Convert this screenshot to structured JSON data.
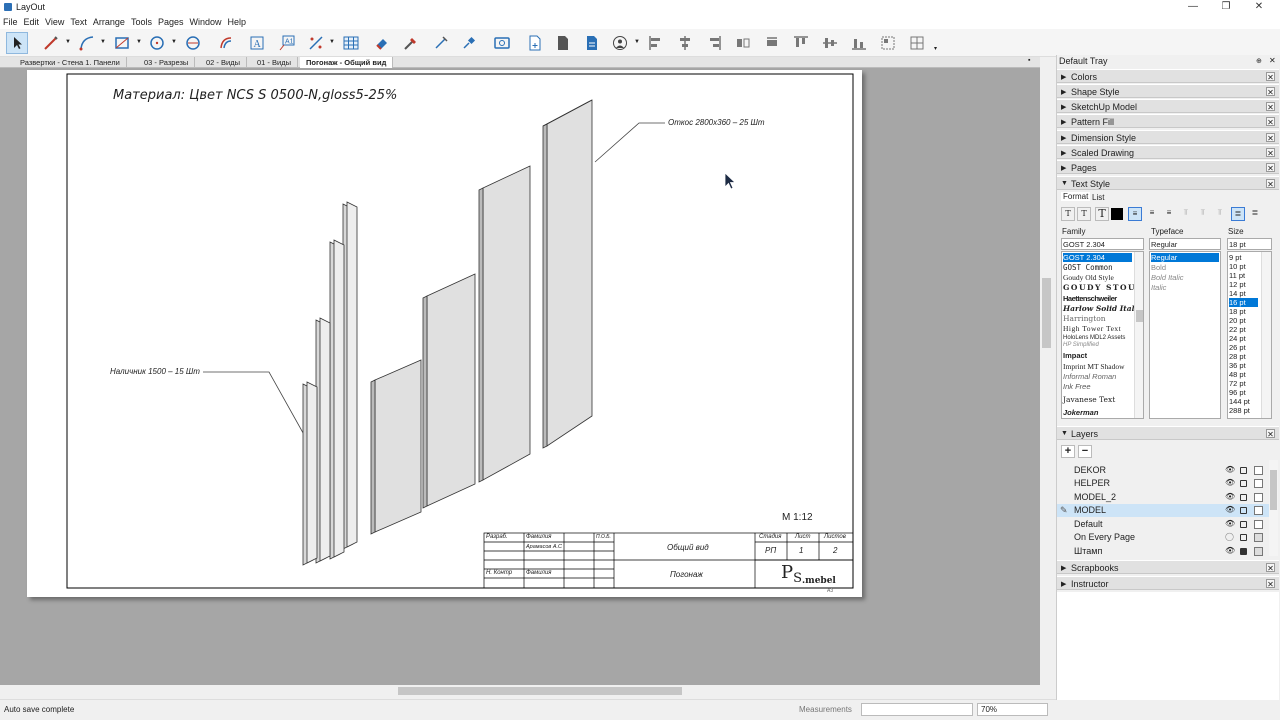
{
  "window": {
    "title": "LayOut",
    "minimize": "—",
    "maximize": "❐",
    "close": "✕"
  },
  "menu": [
    "File",
    "Edit",
    "View",
    "Text",
    "Arrange",
    "Tools",
    "Pages",
    "Window",
    "Help"
  ],
  "toolbar_icons": [
    "select-tool",
    "line-tool",
    "arc-tool",
    "rectangle-tool",
    "circle-tool",
    "polygon-tool",
    "offset-tool",
    "text-tool",
    "label-tool",
    "dimension-tool",
    "table-tool",
    "eraser-tool",
    "style-tool",
    "split-tool",
    "join-tool",
    "presentation",
    "add-page",
    "insert",
    "link",
    "user",
    "align-left",
    "align-center",
    "align-right",
    "flip",
    "rotate",
    "space",
    "distribute",
    "join",
    "group",
    "ungroup"
  ],
  "tabs": [
    "Развертки - Стена 1. Панели",
    "03 - Разрезы",
    "02 - Виды",
    "01 - Виды",
    "Погонаж - Общий вид"
  ],
  "tab_close": "▪",
  "drawing": {
    "title": "Материал: Цвет NCS S 0500-N,gloss5-25%",
    "callout_right": "Откос 2800х360 – 25 Шт",
    "callout_left": "Наличник 1500 – 15 Шт",
    "scale": "М 1:12",
    "stamp": {
      "razrab": "Разраб.",
      "familia1": "Фамилия",
      "author": "Арамасов А.С",
      "col_code": "П.О.Б.",
      "view_name": "Общий вид",
      "stadia_h": "Стадия",
      "list_h": "Лист",
      "listov_h": "Листов",
      "stadia": "РП",
      "list": "1",
      "listov": "2",
      "nkontr": "Н. Контр",
      "familia2": "Фамилия",
      "product": "Погонаж",
      "logo_p": "P",
      "logo_s": "S",
      "logo_rest": ".mebel",
      "format": "А3"
    }
  },
  "status": {
    "text": "Auto save complete",
    "measurements": "Measurements",
    "zoom": "70%"
  },
  "tray": {
    "title": "Default Tray",
    "panels_top": [
      "Colors",
      "Shape Style",
      "SketchUp Model",
      "Pattern Fill",
      "Dimension Style",
      "Scaled Drawing",
      "Pages"
    ],
    "text_style": {
      "label": "Text Style",
      "tabs": [
        "Format",
        "List"
      ],
      "family_label": "Family",
      "typeface_label": "Typeface",
      "size_label": "Size",
      "family_value": "GOST 2.304",
      "typeface_value": "Regular",
      "size_value": "18 pt",
      "families": [
        "GOST 2.304",
        "GOST Common",
        "Goudy Old Style",
        "GOUDY STOUT",
        "Haettenschweiler",
        "Harlow Solid Italic",
        "Harrington",
        "High Tower Text",
        "HoloLens MDL2 Assets",
        "HP Simplified",
        "Impact",
        "Imprint MT Shadow",
        "Informal Roman",
        "Ink Free",
        "Javanese Text",
        "Jokerman"
      ],
      "typefaces": [
        "Regular",
        "Bold",
        "Bold Italic",
        "Italic"
      ],
      "sizes": [
        "9 pt",
        "10 pt",
        "11 pt",
        "12 pt",
        "14 pt",
        "16 pt",
        "18 pt",
        "20 pt",
        "22 pt",
        "24 pt",
        "26 pt",
        "28 pt",
        "36 pt",
        "48 pt",
        "72 pt",
        "96 pt",
        "144 pt",
        "288 pt"
      ],
      "selected_size": "16 pt"
    },
    "layers": {
      "label": "Layers",
      "add": "+",
      "remove": "−",
      "items": [
        "DEKOR",
        "HELPER",
        "MODEL_2",
        "MODEL",
        "Default",
        "On Every Page",
        "Штамп"
      ],
      "active": "MODEL"
    },
    "panels_bottom": [
      "Scrapbooks",
      "Instructor"
    ]
  }
}
